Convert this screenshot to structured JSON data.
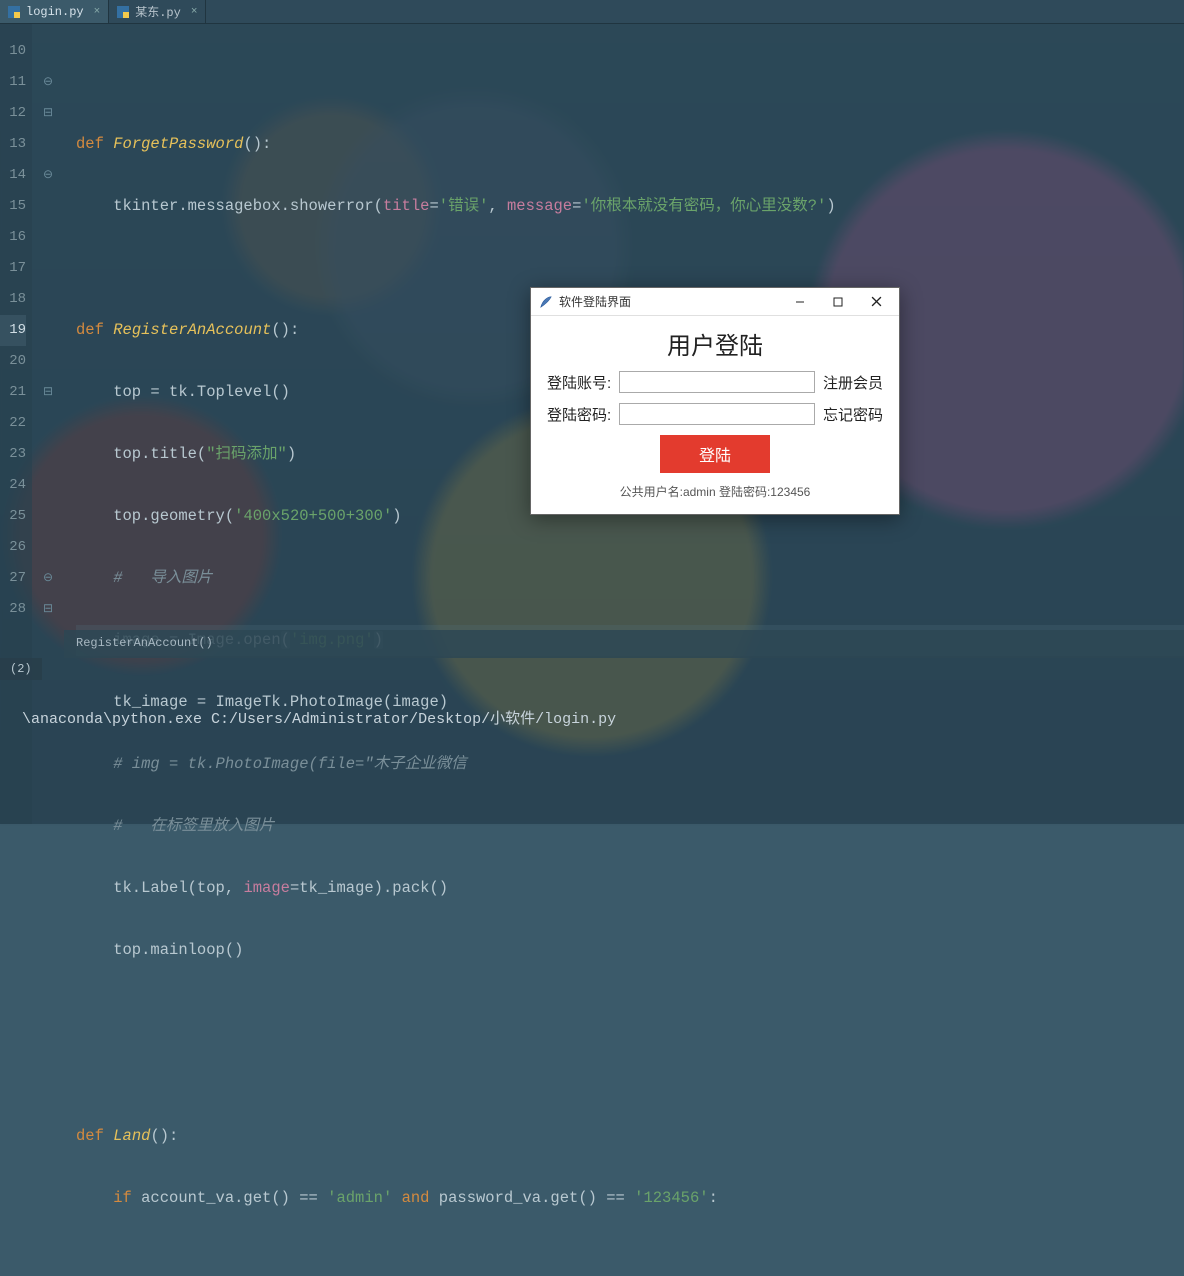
{
  "tabs": [
    {
      "label": "login.py",
      "active": true
    },
    {
      "label": "某东.py",
      "active": false
    }
  ],
  "gutter": {
    "start": 10,
    "count": 19,
    "current": 19
  },
  "code": {
    "l11_def": "def",
    "l11_fn": "ForgetPassword",
    "l11_tail": "():",
    "l12a": "    tkinter.messagebox.showerror(",
    "l12_p1": "title",
    "l12_eq": "=",
    "l12_s1": "'错误'",
    "l12_c": ", ",
    "l12_p2": "message",
    "l12_s2": "'你根本就没有密码，你心里没数?'",
    "l12_end": ")",
    "l14_def": "def",
    "l14_fn": "RegisterAnAccount",
    "l14_tail": "():",
    "l15": "    top = tk.Toplevel()",
    "l16a": "    top.title(",
    "l16s": "\"扫码添加\"",
    "l16b": ")",
    "l17a": "    top.geometry(",
    "l17s": "'400x520+500+300'",
    "l17b": ")",
    "l18": "    #   导入图片",
    "l19a": "    image = Image.open",
    "l19paren_o": "(",
    "l19s": "'img.png'",
    "l19paren_c": ")",
    "l20": "    tk_image = ImageTk.PhotoImage(image)",
    "l21": "    # img = tk.PhotoImage(file=\"木子企业微信",
    "l22": "    #   在标签里放入图片",
    "l23a": "    tk.Label(top, ",
    "l23_p": "image",
    "l23b": "=tk_image).pack()",
    "l24": "    top.mainloop()",
    "l27_def": "def",
    "l27_fn": "Land",
    "l27_tail": "():",
    "l28_if": "    if",
    "l28a": " account_va.get() == ",
    "l28s1": "'admin'",
    "l28_and": " and ",
    "l28b": "password_va.get() == ",
    "l28s2": "'123456'",
    "l28c": ":"
  },
  "breadcrumb": "RegisterAnAccount()",
  "run_tab": "(2)",
  "run_output": "\\anaconda\\python.exe C:/Users/Administrator/Desktop/小软件/login.py",
  "dialog": {
    "window_title": "软件登陆界面",
    "heading": "用户登陆",
    "row1_label": "登陆账号:",
    "row1_link": "注册会员",
    "row2_label": "登陆密码:",
    "row2_link": "忘记密码",
    "submit": "登陆",
    "footer": "公共用户名:admin 登陆密码:123456"
  }
}
